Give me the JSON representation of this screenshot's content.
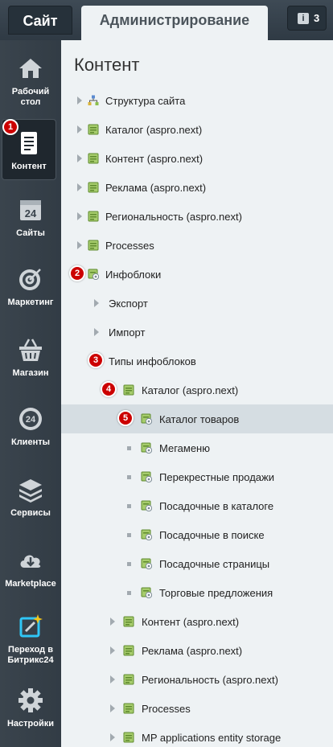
{
  "header": {
    "site_tab": "Сайт",
    "admin_tab": "Администрирование",
    "notifications_count": "3"
  },
  "left_menu": [
    {
      "label1": "Рабочий",
      "label2": "стол",
      "icon": "home-icon"
    },
    {
      "label1": "Контент",
      "label2": "",
      "icon": "document-icon",
      "active": true
    },
    {
      "label1": "Сайты",
      "label2": "",
      "icon": "calendar-24-icon"
    },
    {
      "label1": "Маркетинг",
      "label2": "",
      "icon": "target-icon"
    },
    {
      "label1": "Магазин",
      "label2": "",
      "icon": "basket-icon"
    },
    {
      "label1": "Клиенты",
      "label2": "",
      "icon": "clients-24-icon"
    },
    {
      "label1": "Сервисы",
      "label2": "",
      "icon": "layers-icon"
    },
    {
      "label1": "Marketplace",
      "label2": "",
      "icon": "cloud-download-icon"
    },
    {
      "label1": "Переход в",
      "label2": "Битрикс24",
      "icon": "bitrix24-icon"
    },
    {
      "label1": "Настройки",
      "label2": "",
      "icon": "gear-icon"
    }
  ],
  "page_title": "Контент",
  "tree": [
    {
      "label": "Структура сайта",
      "depth": 0,
      "icon": "structure-icon"
    },
    {
      "label": "Каталог (aspro.next)",
      "depth": 0,
      "icon": "folder-icon"
    },
    {
      "label": "Контент (aspro.next)",
      "depth": 0,
      "icon": "folder-icon"
    },
    {
      "label": "Реклама (aspro.next)",
      "depth": 0,
      "icon": "folder-icon"
    },
    {
      "label": "Региональность (aspro.next)",
      "depth": 0,
      "icon": "folder-icon"
    },
    {
      "label": "Processes",
      "depth": 0,
      "icon": "folder-icon"
    },
    {
      "label": "Инфоблоки",
      "depth": 0,
      "icon": "iblock-icon",
      "badge": "2"
    },
    {
      "label": "Экспорт",
      "depth": 1
    },
    {
      "label": "Импорт",
      "depth": 1
    },
    {
      "label": "Типы инфоблоков",
      "depth": 1,
      "badge": "3"
    },
    {
      "label": "Каталог (aspro.next)",
      "depth": 2,
      "icon": "folder-icon",
      "badge": "4"
    },
    {
      "label": "Каталог товаров",
      "depth": 3,
      "icon": "iblock-icon",
      "badge": "5",
      "selected": true
    },
    {
      "label": "Мегаменю",
      "depth": 3,
      "icon": "iblock-icon"
    },
    {
      "label": "Перекрестные продажи",
      "depth": 3,
      "icon": "iblock-icon"
    },
    {
      "label": "Посадочные в каталоге",
      "depth": 3,
      "icon": "iblock-icon"
    },
    {
      "label": "Посадочные в поиске",
      "depth": 3,
      "icon": "iblock-icon"
    },
    {
      "label": "Посадочные страницы",
      "depth": 3,
      "icon": "iblock-icon"
    },
    {
      "label": "Торговые предложения",
      "depth": 3,
      "icon": "iblock-icon"
    },
    {
      "label": "Контент (aspro.next)",
      "depth": 2,
      "icon": "folder-icon"
    },
    {
      "label": "Реклама (aspro.next)",
      "depth": 2,
      "icon": "folder-icon"
    },
    {
      "label": "Региональность (aspro.next)",
      "depth": 2,
      "icon": "folder-icon"
    },
    {
      "label": "Processes",
      "depth": 2,
      "icon": "folder-icon"
    },
    {
      "label": "MP applications entity storage",
      "depth": 2,
      "icon": "folder-icon"
    }
  ],
  "content_badge": "1",
  "colors": {
    "accent_badge": "#cc0000",
    "selected_row": "#d5dde2"
  }
}
